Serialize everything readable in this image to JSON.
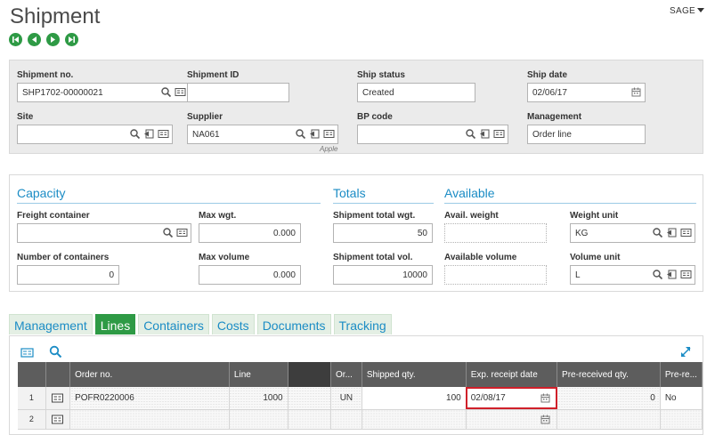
{
  "page": {
    "title": "Shipment",
    "user_menu": "SAGE"
  },
  "nav": {
    "icons": [
      "first-record-icon",
      "previous-record-icon",
      "next-record-icon",
      "last-record-icon"
    ]
  },
  "header": {
    "shipment_no": {
      "label": "Shipment no.",
      "value": "SHP1702-00000021"
    },
    "shipment_id": {
      "label": "Shipment ID",
      "value": ""
    },
    "ship_status": {
      "label": "Ship status",
      "value": "Created"
    },
    "ship_date": {
      "label": "Ship date",
      "value": "02/06/17"
    },
    "site": {
      "label": "Site",
      "value": ""
    },
    "supplier": {
      "label": "Supplier",
      "value": "NA061",
      "caption": "Apple"
    },
    "bp_code": {
      "label": "BP code",
      "value": ""
    },
    "management": {
      "label": "Management",
      "value": "Order line"
    }
  },
  "capacity": {
    "title": "Capacity",
    "freight_container": {
      "label": "Freight container",
      "value": ""
    },
    "max_wgt": {
      "label": "Max wgt.",
      "value": "0.000"
    },
    "number_of_containers": {
      "label": "Number of containers",
      "value": "0"
    },
    "max_volume": {
      "label": "Max volume",
      "value": "0.000"
    }
  },
  "totals": {
    "title": "Totals",
    "total_wgt": {
      "label": "Shipment total wgt.",
      "value": "50"
    },
    "total_vol": {
      "label": "Shipment total vol.",
      "value": "10000"
    }
  },
  "available": {
    "title": "Available",
    "avail_weight": {
      "label": "Avail. weight",
      "value": ""
    },
    "weight_unit": {
      "label": "Weight unit",
      "value": "KG"
    },
    "available_volume": {
      "label": "Available volume",
      "value": ""
    },
    "volume_unit": {
      "label": "Volume unit",
      "value": "L"
    }
  },
  "tabs": [
    {
      "label": "Management",
      "active": false
    },
    {
      "label": "Lines",
      "active": true
    },
    {
      "label": "Containers",
      "active": false
    },
    {
      "label": "Costs",
      "active": false
    },
    {
      "label": "Documents",
      "active": false
    },
    {
      "label": "Tracking",
      "active": false
    }
  ],
  "grid": {
    "columns": [
      "Order no.",
      "Line",
      "",
      "Or...",
      "Shipped qty.",
      "Exp. receipt date",
      "Pre-received qty.",
      "Pre-re..."
    ],
    "rows": [
      {
        "num": "1",
        "order_no": "POFR0220006",
        "line": "1000",
        "blank": "",
        "or": "UN",
        "shipped_qty": "100",
        "exp_receipt_date": "02/08/17",
        "pre_received_qty": "0",
        "pre_re": "No"
      },
      {
        "num": "2",
        "order_no": "",
        "line": "",
        "blank": "",
        "or": "",
        "shipped_qty": "",
        "exp_receipt_date": "",
        "pre_received_qty": "",
        "pre_re": ""
      }
    ]
  },
  "colors": {
    "accent_green": "#2e9a45",
    "section_blue": "#1b8cc5",
    "highlight_red": "#d0202a"
  }
}
